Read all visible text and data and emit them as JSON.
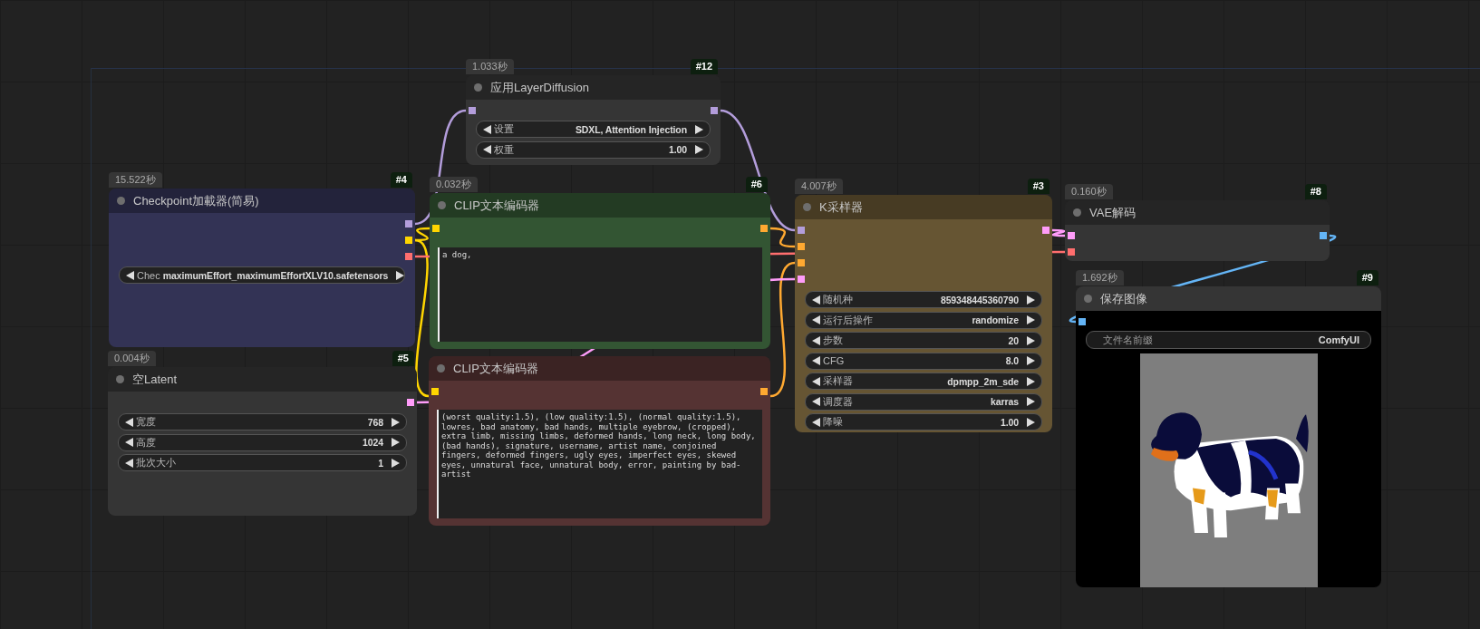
{
  "nodes": [
    {
      "id": "#12",
      "time": "1.033秒",
      "title": "应用LayerDiffusion",
      "color": "#353535",
      "inputs": [
        {
          "color": "#b39ddb"
        }
      ],
      "outputs": [
        {
          "color": "#b39ddb"
        }
      ],
      "widgets": [
        {
          "kind": "combo",
          "label": "设置",
          "value": "SDXL, Attention Injection"
        },
        {
          "kind": "number",
          "label": "权重",
          "value": "1.00"
        }
      ]
    },
    {
      "id": "#4",
      "time": "15.522秒",
      "title": "Checkpoint加載器(简易)",
      "color": "#333355",
      "outputs": [
        {
          "color": "#b39ddb"
        },
        {
          "color": "#ffd500"
        },
        {
          "color": "#ff6e6e"
        }
      ],
      "widgets": [
        {
          "kind": "combo",
          "label": "Chec",
          "value": "maximumEffort_maximumEffortXLV10.safetensors"
        }
      ]
    },
    {
      "id": "#6",
      "time": "0.032秒",
      "title": "CLIP文本编码器",
      "color": "#335533",
      "inputs": [
        {
          "color": "#ffd500"
        }
      ],
      "outputs": [
        {
          "color": "#ffa931"
        }
      ],
      "widgets": [
        {
          "kind": "text",
          "value": "a dog,"
        }
      ]
    },
    {
      "title": "CLIP文本编码器",
      "color": "#553333",
      "inputs": [
        {
          "color": "#ffd500"
        }
      ],
      "outputs": [
        {
          "color": "#ffa931"
        }
      ],
      "widgets": [
        {
          "kind": "text",
          "value": "(worst quality:1.5), (low quality:1.5), (normal quality:1.5), lowres, bad anatomy, bad hands, multiple eyebrow, (cropped), extra limb, missing limbs, deformed hands, long neck, long body, (bad hands), signature, username, artist name, conjoined fingers, deformed fingers, ugly eyes, imperfect eyes, skewed eyes, unnatural face, unnatural body, error, painting by bad-artist"
        }
      ]
    },
    {
      "id": "#5",
      "time": "0.004秒",
      "title": "空Latent",
      "color": "#353535",
      "outputs": [
        {
          "color": "#ff9cf9"
        }
      ],
      "widgets": [
        {
          "kind": "number",
          "label": "宽度",
          "value": "768"
        },
        {
          "kind": "number",
          "label": "高度",
          "value": "1024"
        },
        {
          "kind": "number",
          "label": "批次大小",
          "value": "1"
        }
      ]
    },
    {
      "id": "#3",
      "time": "4.007秒",
      "title": "K采样器",
      "color": "#665533",
      "inputs": [
        {
          "color": "#b39ddb"
        },
        {
          "color": "#ffa931"
        },
        {
          "color": "#ffa931"
        },
        {
          "color": "#ff9cf9"
        }
      ],
      "outputs": [
        {
          "color": "#ff9cf9"
        }
      ],
      "widgets": [
        {
          "kind": "number",
          "label": "随机种",
          "value": "859348445360790"
        },
        {
          "kind": "combo",
          "label": "运行后操作",
          "value": "randomize"
        },
        {
          "kind": "number",
          "label": "步数",
          "value": "20"
        },
        {
          "kind": "number",
          "label": "CFG",
          "value": "8.0"
        },
        {
          "kind": "combo",
          "label": "采样器",
          "value": "dpmpp_2m_sde"
        },
        {
          "kind": "combo",
          "label": "调度器",
          "value": "karras"
        },
        {
          "kind": "number",
          "label": "降噪",
          "value": "1.00"
        }
      ]
    },
    {
      "id": "#8",
      "time": "0.160秒",
      "title": "VAE解码",
      "color": "#353535",
      "inputs": [
        {
          "color": "#ff9cf9"
        },
        {
          "color": "#ff6e6e"
        }
      ],
      "outputs": [
        {
          "color": "#64b5f6"
        }
      ]
    },
    {
      "id": "#9",
      "time": "1.692秒",
      "title": "保存图像",
      "color": "#353535",
      "inputs": [
        {
          "color": "#64b5f6"
        }
      ],
      "widgets": [
        {
          "kind": "field",
          "label": "文件名前缀",
          "value": "ComfyUI"
        },
        {
          "kind": "picture"
        }
      ]
    }
  ]
}
